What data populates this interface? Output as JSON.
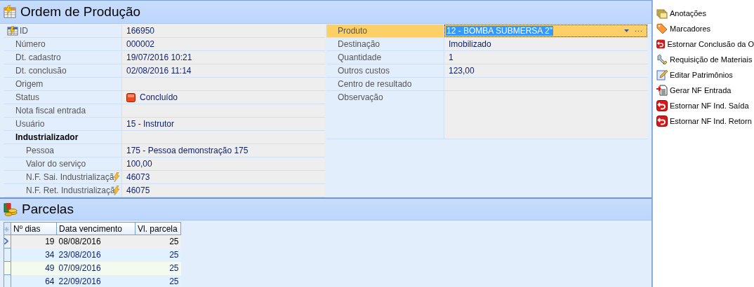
{
  "order_panel": {
    "title": "Ordem de Produção",
    "left_fields": [
      {
        "label": "ID",
        "value": "166950",
        "kind": "key"
      },
      {
        "label": "Número",
        "value": "000002",
        "kind": "text"
      },
      {
        "label": "Dt. cadastro",
        "value": "19/07/2016 10:21",
        "kind": "text"
      },
      {
        "label": "Dt. conclusão",
        "value": "02/08/2016 11:14",
        "kind": "text"
      },
      {
        "label": "Origem",
        "kind": "text"
      },
      {
        "label": "Status",
        "value": "Concluído",
        "kind": "status"
      },
      {
        "label": "Nota fiscal entrada",
        "kind": "text"
      },
      {
        "label": "Usuário",
        "value": "15 - Instrutor",
        "kind": "text"
      },
      {
        "label": "Industrializador",
        "kind": "group",
        "children": [
          {
            "label": "Pessoa",
            "value": "175 - Pessoa demonstração 175",
            "kind": "text"
          },
          {
            "label": "Valor do serviço",
            "value": "100,00",
            "kind": "text"
          },
          {
            "label": "N.F. Sai. Industrializaçã",
            "value": "46073",
            "kind": "linked"
          },
          {
            "label": "N.F. Ret. Industrializaçã",
            "value": "46075",
            "kind": "linked"
          }
        ]
      }
    ],
    "right_fields": [
      {
        "label": "Produto",
        "value": "12 - BOMBA SUBMERSA 2\"",
        "kind": "lookup",
        "selected": true
      },
      {
        "label": "Destinação",
        "value": "Imobilizado",
        "kind": "text",
        "selected": false
      },
      {
        "label": "Quantidade",
        "value": "1",
        "kind": "text",
        "selected": false
      },
      {
        "label": "Outros custos",
        "value": "123,00",
        "kind": "text",
        "selected": false
      },
      {
        "label": "Centro de resultado",
        "kind": "text",
        "selected": false
      },
      {
        "label": "Observação",
        "kind": "memo",
        "selected": false
      }
    ]
  },
  "installments_panel": {
    "title": "Parcelas",
    "table": {
      "columns": [
        "Nº dias",
        "Data vencimento",
        "Vl. parcela"
      ],
      "rows": [
        {
          "cells": [
            "19",
            "08/08/2016",
            "25"
          ],
          "selected": true
        },
        {
          "cells": [
            "34",
            "23/08/2016",
            "25"
          ],
          "selected": false
        },
        {
          "cells": [
            "49",
            "07/09/2016",
            "25"
          ],
          "selected": false
        },
        {
          "cells": [
            "64",
            "22/09/2016",
            "25"
          ],
          "selected": false
        }
      ]
    }
  },
  "actions": [
    {
      "label": "Anotações",
      "kind": "notes"
    },
    {
      "label": "Marcadores",
      "kind": "tag"
    },
    {
      "label": "Estornar Conclusão da O",
      "kind": "undo"
    },
    {
      "label": "Requisição de Materiais",
      "kind": "tool"
    },
    {
      "label": "Editar Patrimônios",
      "kind": "edit"
    },
    {
      "label": "Gerar NF Entrada",
      "kind": "document"
    },
    {
      "label": "Estornar NF Ind. Saída",
      "kind": "undo"
    },
    {
      "label": "Estornar NF Ind. Retorn",
      "kind": "undo"
    }
  ]
}
